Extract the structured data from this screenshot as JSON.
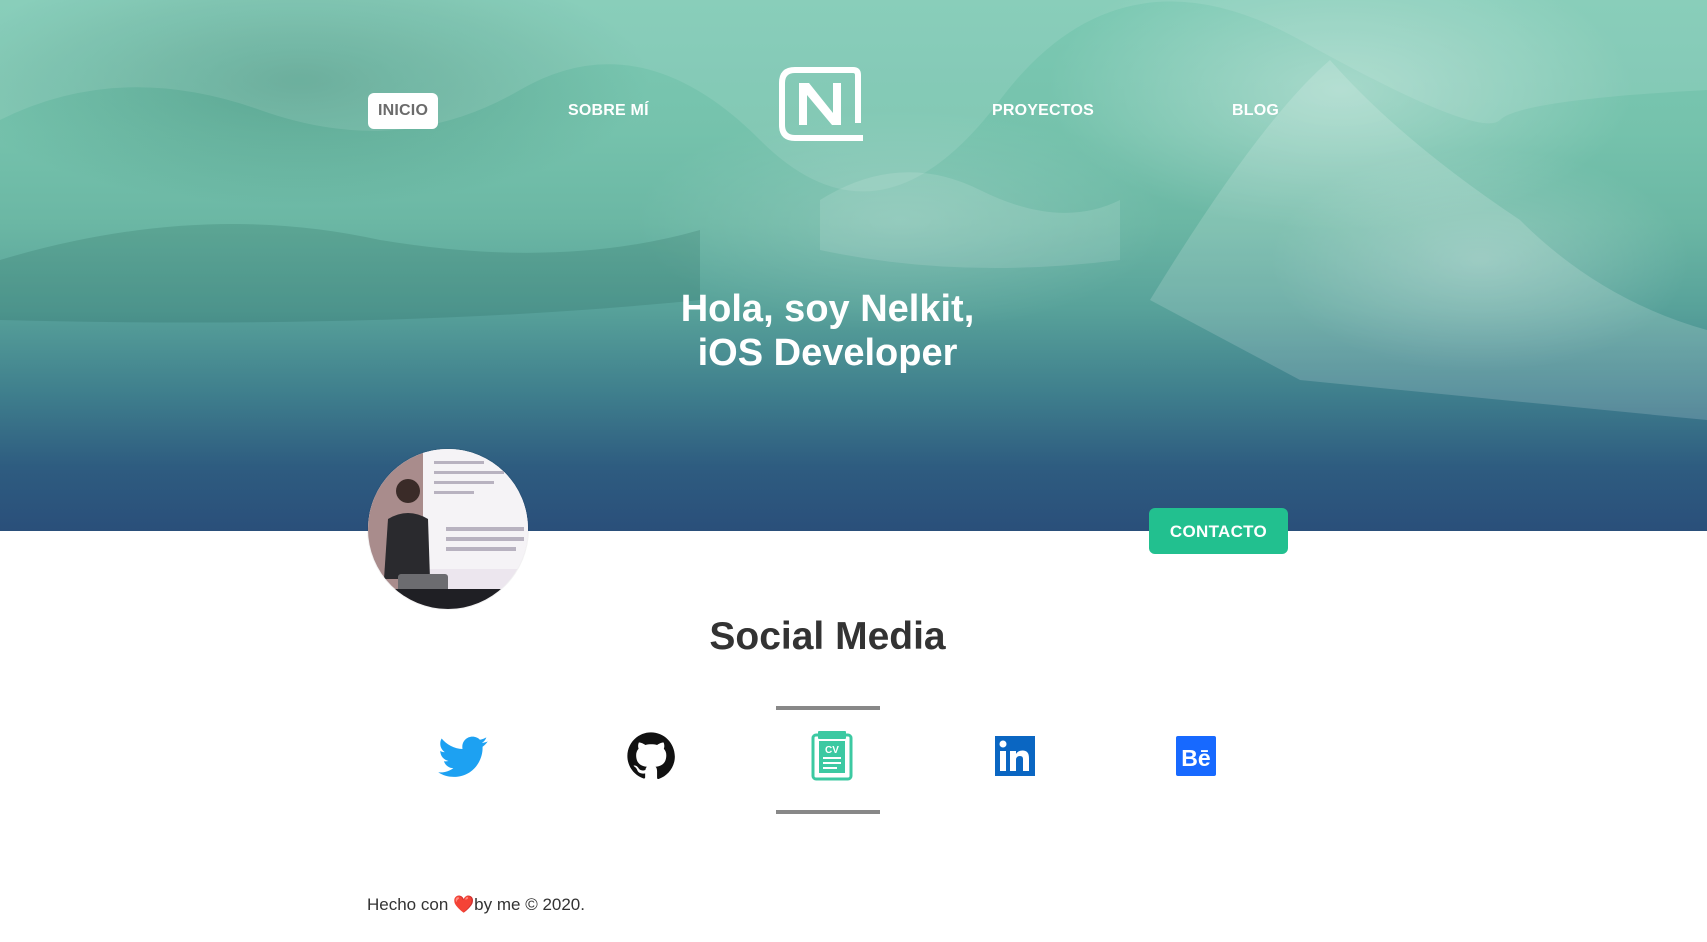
{
  "nav": {
    "items": [
      {
        "label": "INICIO",
        "active": true
      },
      {
        "label": "SOBRE MÍ",
        "active": false
      },
      {
        "label": "PROYECTOS",
        "active": false
      },
      {
        "label": "BLOG",
        "active": false
      }
    ],
    "logo_letter": "N"
  },
  "hero": {
    "title_line1": "Hola, soy Nelkit,",
    "title_line2": "iOS Developer"
  },
  "contact_button": "CONTACTO",
  "social": {
    "title": "Social Media",
    "links": [
      {
        "icon": "twitter-icon",
        "color": "#1da1f2"
      },
      {
        "icon": "github-icon",
        "color": "#111111"
      },
      {
        "icon": "cv-icon",
        "color": "#3cc9a2",
        "label": "CV"
      },
      {
        "icon": "linkedin-icon",
        "color": "#0a66c2",
        "label": "in"
      },
      {
        "icon": "behance-icon",
        "color": "#1769ff",
        "label": "Bē"
      }
    ]
  },
  "footer": {
    "text_before": "Hecho con ",
    "heart": "❤️",
    "text_after": "by me © 2020."
  },
  "colors": {
    "accent": "#22c08f",
    "hero_top": "#7cc9b3",
    "hero_bottom": "#2a4f7a"
  }
}
